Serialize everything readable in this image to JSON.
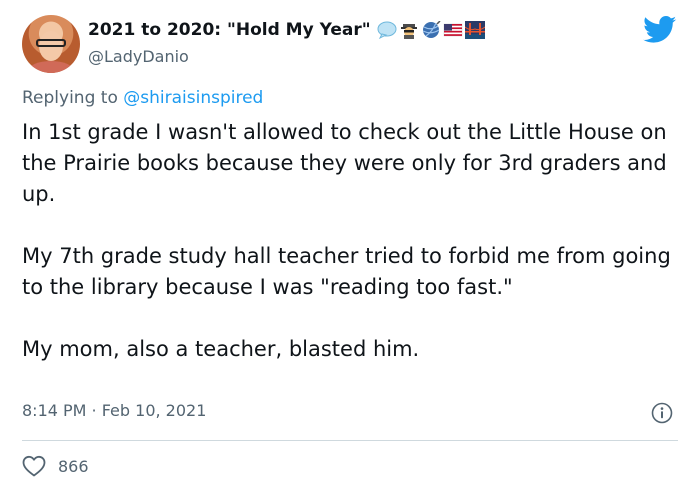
{
  "author": {
    "display_name": "2021 to 2020: \"Hold My Year\"",
    "handle": "@LadyDanio",
    "name_emojis": [
      "speech-bubble",
      "spy-detective",
      "yarn-ball",
      "us-flag",
      "bridge-at-night"
    ]
  },
  "reply": {
    "prefix": "Replying to",
    "mention": "@shiraisinspired"
  },
  "tweet": {
    "paragraphs": [
      "In 1st grade I wasn't allowed to check out the Little House on the Prairie books because they were only for 3rd graders and up.",
      "My 7th grade study hall teacher tried to forbid me from going to the library because I was \"reading too fast.\"",
      "My mom, also a teacher, blasted him."
    ],
    "timestamp": "8:14 PM · Feb 10, 2021"
  },
  "engagement": {
    "likes": "866"
  },
  "colors": {
    "twitter_blue": "#1d9bf0",
    "secondary_text": "#536471",
    "divider": "#cfd9de"
  },
  "icons": {
    "logo": "twitter-bird-icon",
    "info": "info-icon",
    "like": "heart-icon"
  }
}
